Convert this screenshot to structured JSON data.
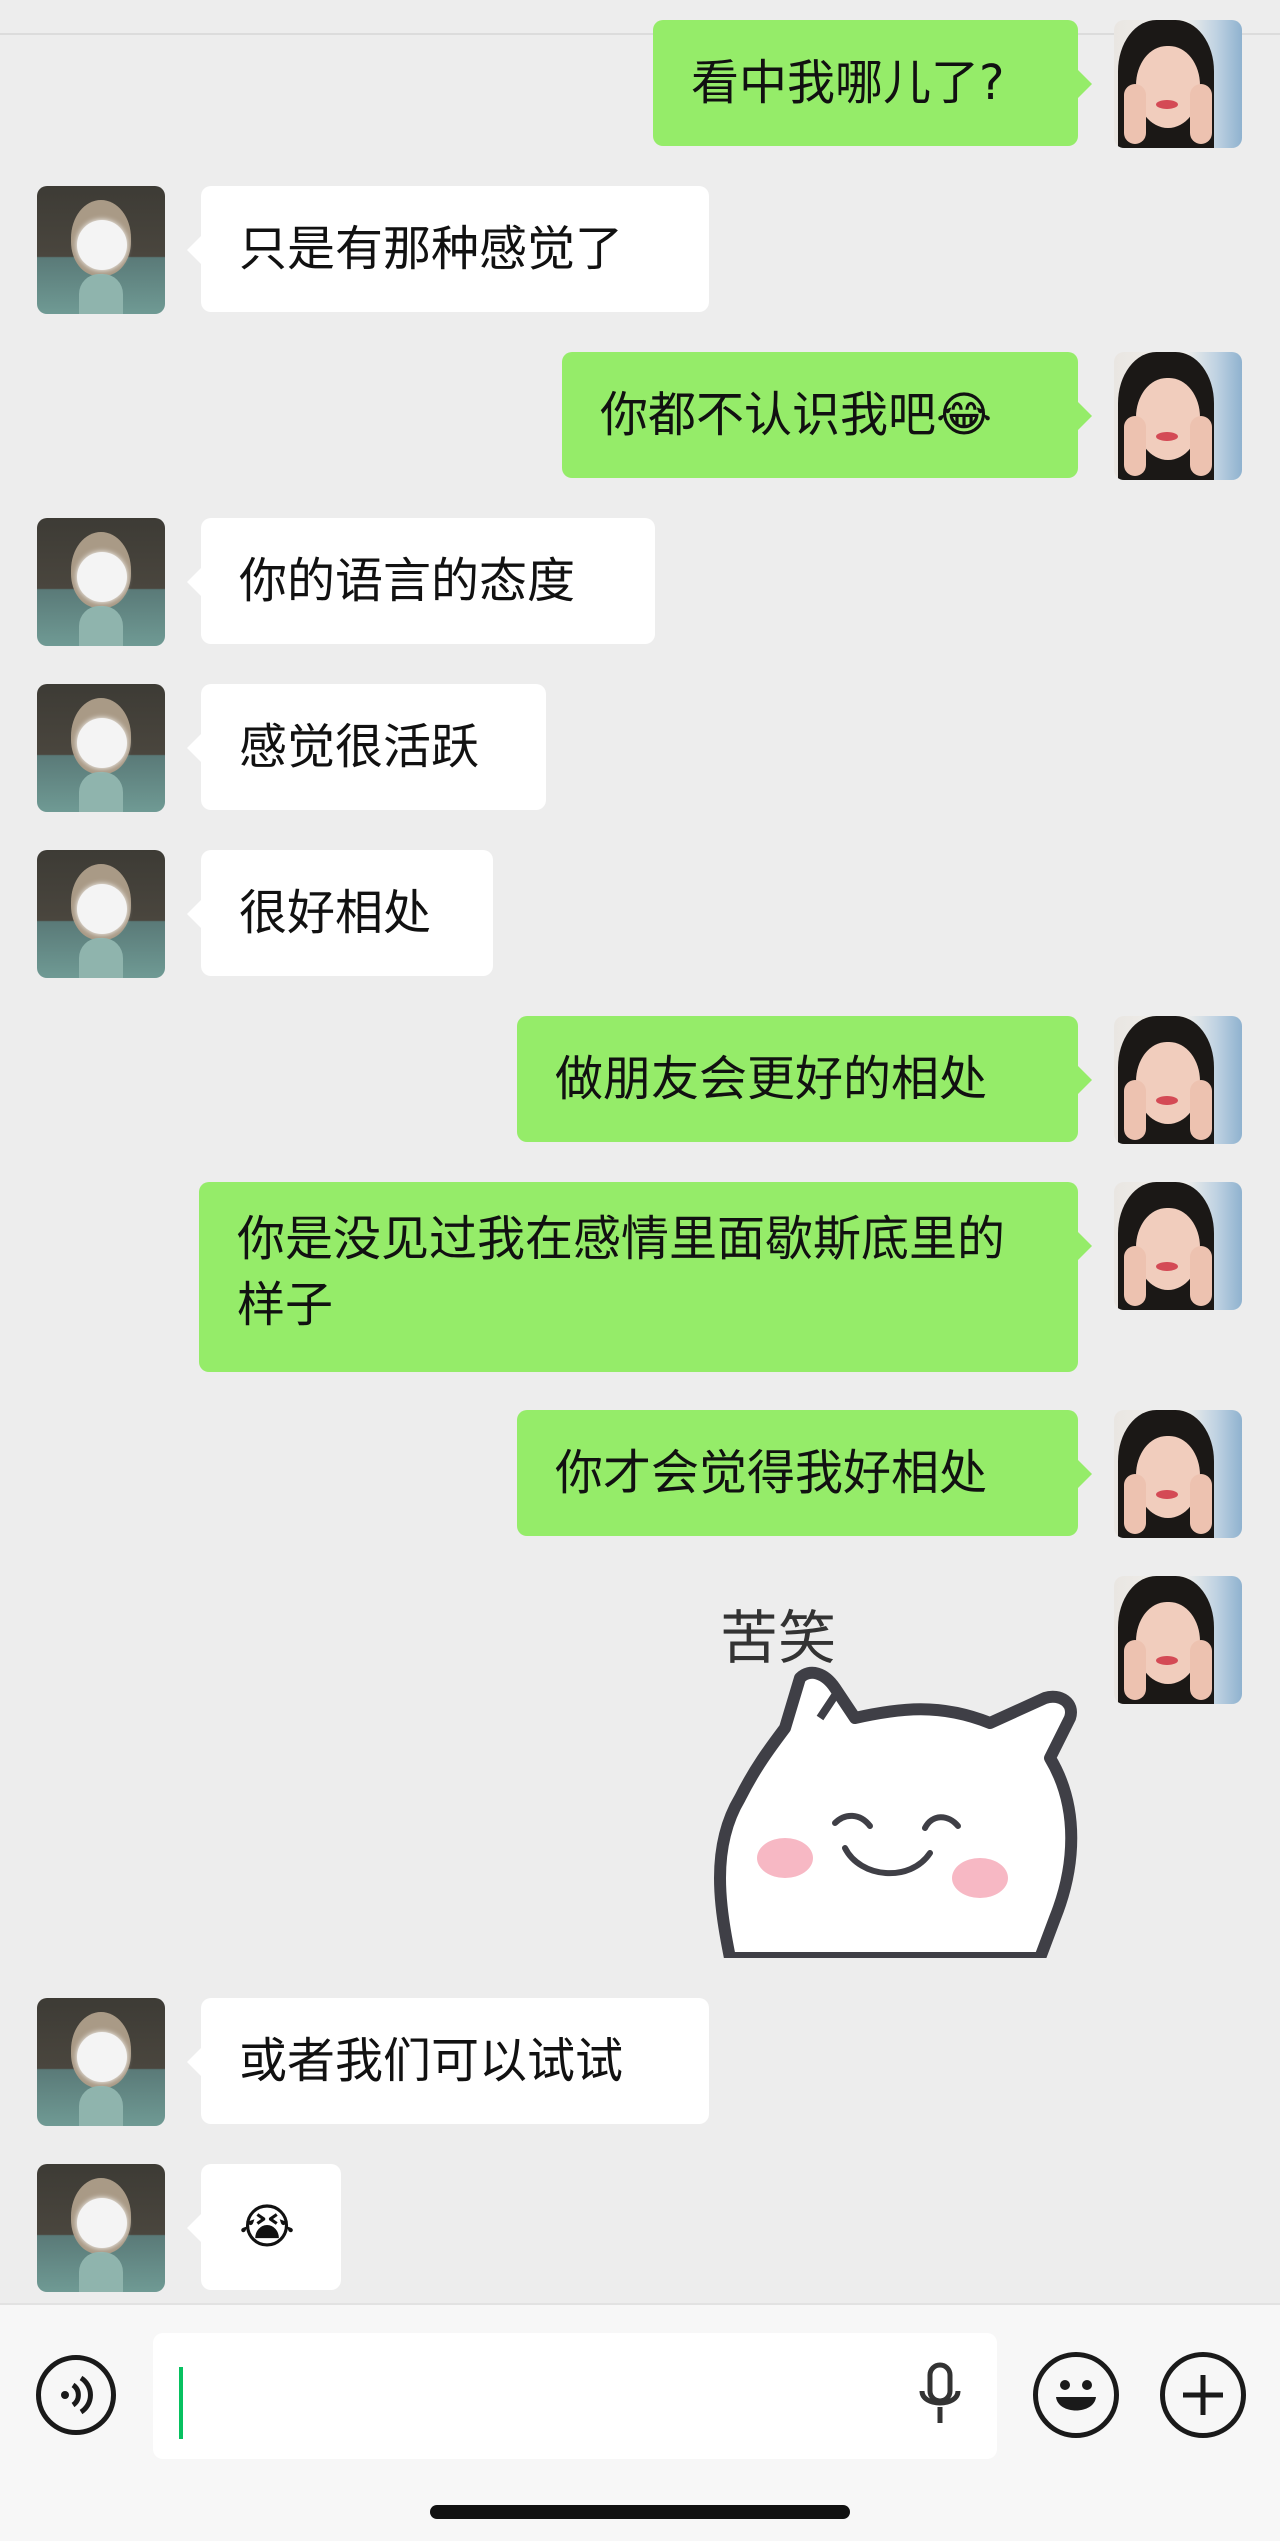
{
  "messages": [
    {
      "side": "out",
      "text": "看中我哪儿了?"
    },
    {
      "side": "in",
      "text": "只是有那种感觉了"
    },
    {
      "side": "out",
      "text": "你都不认识我吧😂"
    },
    {
      "side": "in",
      "text": "你的语言的态度"
    },
    {
      "side": "in",
      "text": "感觉很活跃"
    },
    {
      "side": "in",
      "text": "很好相处"
    },
    {
      "side": "out",
      "text": "做朋友会更好的相处"
    },
    {
      "side": "out",
      "text": "你是没见过我在感情里面歇斯底里的样子"
    },
    {
      "side": "out",
      "text": "你才会觉得我好相处"
    },
    {
      "side": "out",
      "sticker": "smiling-cat-sticker",
      "sticker_text": "苦笑"
    },
    {
      "side": "in",
      "text": "或者我们可以试试"
    },
    {
      "side": "in",
      "text": "😭"
    }
  ],
  "input_bar": {
    "voice_icon": "voice-toggle-icon",
    "mic_icon": "microphone-icon",
    "emoji_icon": "emoji-icon",
    "plus_icon": "plus-icon",
    "value": ""
  },
  "colors": {
    "background": "#ededed",
    "incoming_bubble": "#ffffff",
    "outgoing_bubble": "#95ec69",
    "caret": "#07c160"
  }
}
